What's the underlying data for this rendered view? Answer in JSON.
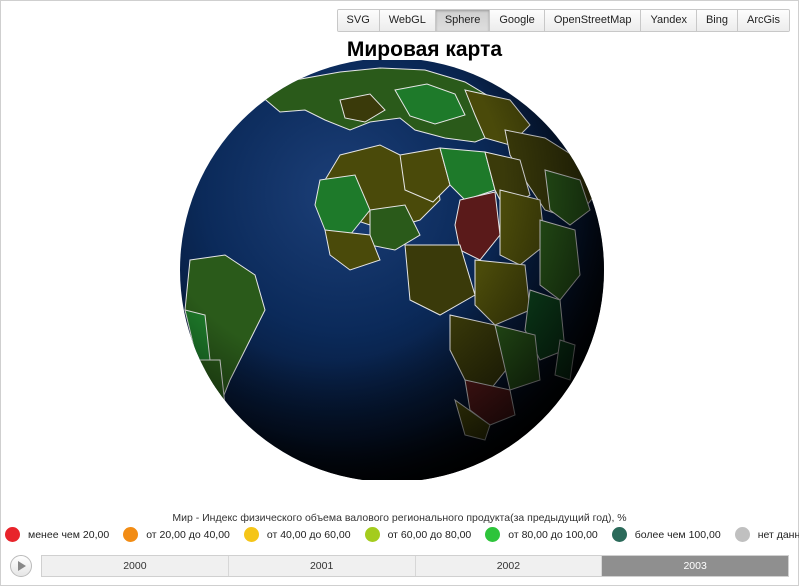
{
  "toolbar": {
    "tabs": [
      "SVG",
      "WebGL",
      "Sphere",
      "Google",
      "OpenStreetMap",
      "Yandex",
      "Bing",
      "ArcGis"
    ],
    "active": "Sphere"
  },
  "title": "Мировая карта",
  "legend": {
    "title": "Мир - Индекс физического объема валового регионального продукта(за предыдущий год), %",
    "items": [
      {
        "label": "менее чем 20,00",
        "color": "#e8242b"
      },
      {
        "label": "от 20,00 до 40,00",
        "color": "#f28c14"
      },
      {
        "label": "от 40,00 до 60,00",
        "color": "#f5c518"
      },
      {
        "label": "от 60,00 до 80,00",
        "color": "#a4cc1e"
      },
      {
        "label": "от 80,00 до 100,00",
        "color": "#2ec43b"
      },
      {
        "label": "более чем 100,00",
        "color": "#2b6a5a"
      },
      {
        "label": "нет данных",
        "color": "#c0c0c0"
      }
    ]
  },
  "timeline": {
    "years": [
      "2000",
      "2001",
      "2002",
      "2003"
    ],
    "active": "2003"
  },
  "globe": {
    "ocean_color": "#0b2a5a",
    "country_colors": [
      "#1e7a2a",
      "#4a4a0a",
      "#5a1a1a",
      "#2a5a1a",
      "#3a3a0a",
      "#0e4a20"
    ]
  }
}
